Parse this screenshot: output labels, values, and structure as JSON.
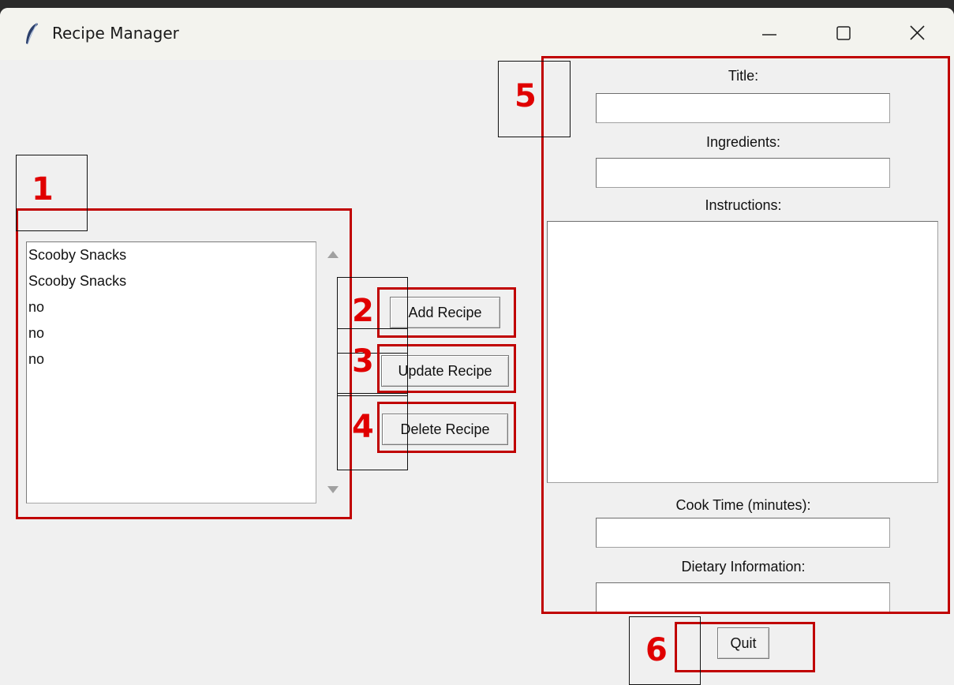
{
  "window": {
    "title": "Recipe Manager",
    "icon": "feather-icon",
    "controls": [
      "minimize-icon",
      "maximize-icon",
      "close-icon"
    ]
  },
  "recipe_list": {
    "items": [
      "Scooby Snacks",
      "Scooby Snacks",
      "no",
      "no",
      "no"
    ]
  },
  "buttons": {
    "add": "Add Recipe",
    "update": "Update Recipe",
    "delete": "Delete Recipe",
    "quit": "Quit"
  },
  "form": {
    "title_label": "Title:",
    "title_value": "",
    "ingredients_label": "Ingredients:",
    "ingredients_value": "",
    "instructions_label": "Instructions:",
    "instructions_value": "",
    "cook_time_label": "Cook Time (minutes):",
    "cook_time_value": "",
    "dietary_label": "Dietary Information:",
    "dietary_value": ""
  },
  "annotations": {
    "n1": "1",
    "n2": "2",
    "n3": "3",
    "n4": "4",
    "n5": "5",
    "n6": "6",
    "color": "#e00000"
  }
}
